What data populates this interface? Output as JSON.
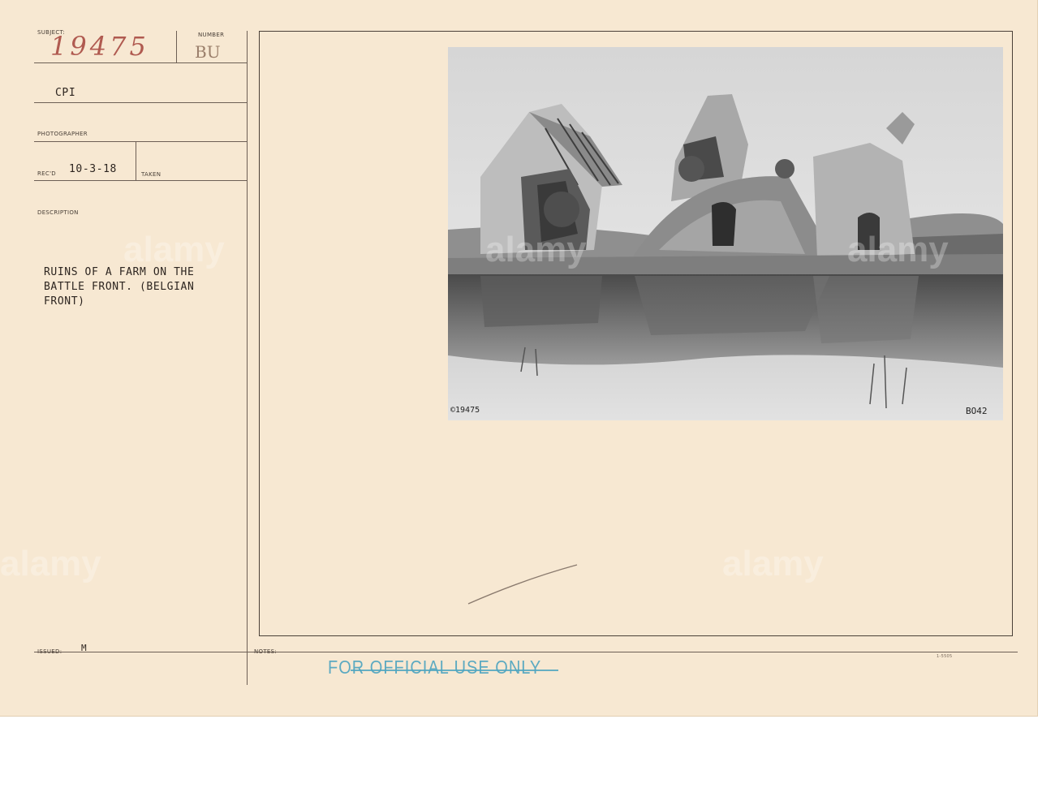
{
  "record": {
    "subject_label": "SUBJECT:",
    "subject_number": "19475",
    "number_label": "NUMBER",
    "number_value": "BU",
    "organization": "CPI",
    "photographer_label": "PHOTOGRAPHER",
    "received_label": "REC'D",
    "received_date": "10-3-18",
    "taken_label": "TAKEN",
    "description_label": "DESCRIPTION",
    "description_lines": [
      "RUINS OF A FARM ON THE",
      "BATTLE FRONT. (BELGIAN",
      "FRONT)"
    ],
    "issued_label": "ISSUED:",
    "issued_value": "M",
    "notes_label": "NOTES:",
    "form_code": "1-5505"
  },
  "photo": {
    "negative_number": "©19475",
    "code": "BO42"
  },
  "stamp": {
    "text": "FOR OFFICIAL USE ONLY"
  },
  "watermark": {
    "text": "alamy"
  },
  "colors": {
    "card": "#f7e8d2",
    "rule": "#6d5f55",
    "stamp": "#4da4c0",
    "handwriting": "#b05a50"
  }
}
